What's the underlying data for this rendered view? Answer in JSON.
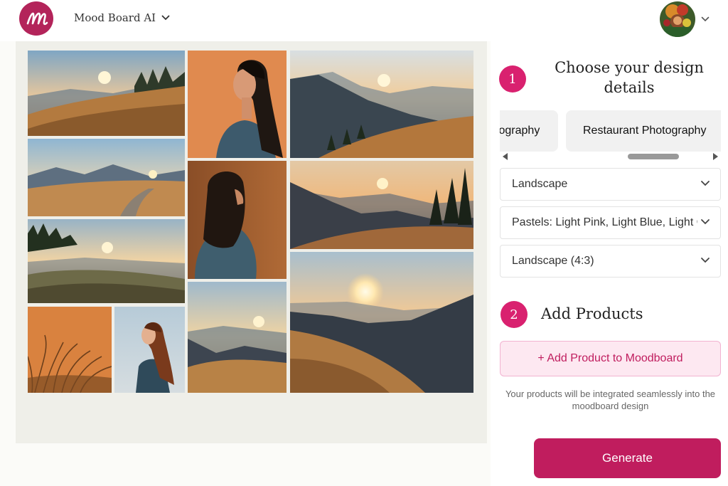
{
  "header": {
    "app_name": "Mood Board AI",
    "logo_letter": "m",
    "brand_color": "#b3245a"
  },
  "board": {
    "tiles": [
      {
        "name": "sunset-meadow-photo",
        "kind": "meadow"
      },
      {
        "name": "woman-profile-photo",
        "kind": "woman"
      },
      {
        "name": "mountain-valley-sunset-photo",
        "kind": "mountain"
      },
      {
        "name": "mountain-path-photo",
        "kind": "meadow"
      },
      {
        "name": "woman-back-photo",
        "kind": "woman"
      },
      {
        "name": "forest-ridge-sunset-photo",
        "kind": "mountain"
      },
      {
        "name": "grass-hill-sunset-photo",
        "kind": "meadow"
      },
      {
        "name": "valley-sun-photo",
        "kind": "mountain"
      },
      {
        "name": "big-sun-mountain-photo",
        "kind": "mountain"
      },
      {
        "name": "dry-grass-photo",
        "kind": "grass"
      },
      {
        "name": "woman-long-hair-photo",
        "kind": "woman"
      }
    ]
  },
  "panel": {
    "step1": {
      "number": "1",
      "title_line1": "Choose your design",
      "title_line2": "details"
    },
    "style_chips": [
      {
        "label": "Product Photography",
        "selected": false
      },
      {
        "label": "Restaurant Photography",
        "selected": false
      }
    ],
    "selects": {
      "orientation": "Landscape",
      "palette": "Pastels: Light Pink, Light Blue, Light Green",
      "aspect": "Landscape (4:3)"
    },
    "step2": {
      "number": "2",
      "title": "Add Products"
    },
    "add_product_label": "+ Add Product to Moodboard",
    "helper_text": "Your products will be integrated seamlessly into the moodboard design",
    "generate_label": "Generate",
    "accent_color": "#c01d5e"
  }
}
